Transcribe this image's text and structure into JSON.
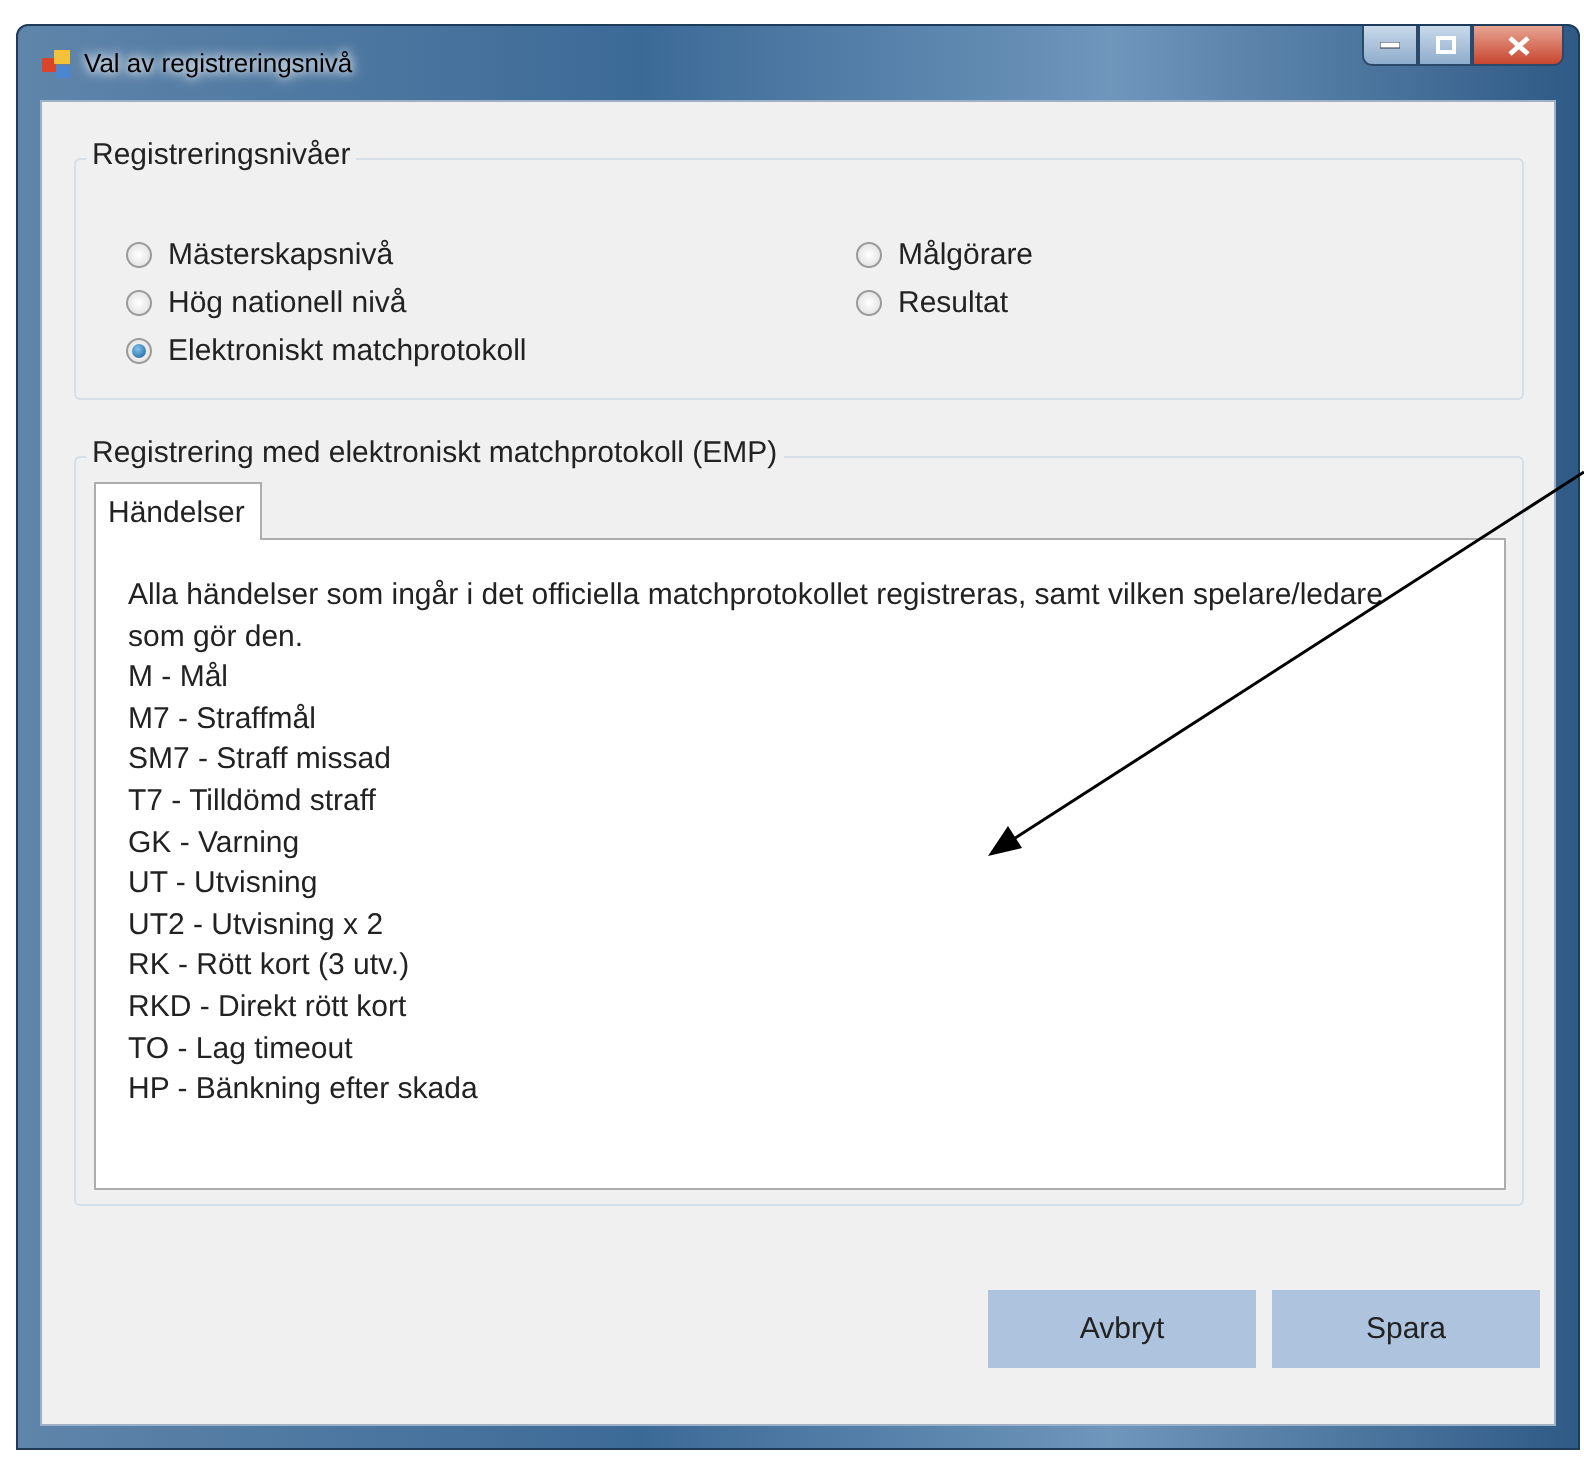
{
  "window": {
    "title": "Val av registreringsnivå"
  },
  "levels_group": {
    "title": "Registreringsnivåer",
    "options": [
      {
        "label": "Mästerskapsnivå",
        "selected": false
      },
      {
        "label": "Målgörare",
        "selected": false
      },
      {
        "label": "Hög nationell nivå",
        "selected": false
      },
      {
        "label": "Resultat",
        "selected": false
      },
      {
        "label": "Elektroniskt matchprotokoll",
        "selected": true
      }
    ]
  },
  "emp_group": {
    "title": "Registrering med elektroniskt matchprotokoll (EMP)",
    "tabs": [
      {
        "label": "Händelser",
        "selected": true
      }
    ],
    "description": "Alla händelser som ingår i det officiella matchprotokollet registreras, samt vilken spelare/ledare som gör den.",
    "events": [
      "M - Mål",
      "M7 - Straffmål",
      "SM7 - Straff missad",
      "T7 - Tilldömd straff",
      "GK - Varning",
      "UT - Utvisning",
      "UT2 - Utvisning x 2",
      "RK - Rött kort (3 utv.)",
      "RKD - Direkt rött kort",
      "TO - Lag timeout",
      "HP - Bänkning efter skada"
    ]
  },
  "buttons": [
    "Avbryt",
    "Spara"
  ]
}
